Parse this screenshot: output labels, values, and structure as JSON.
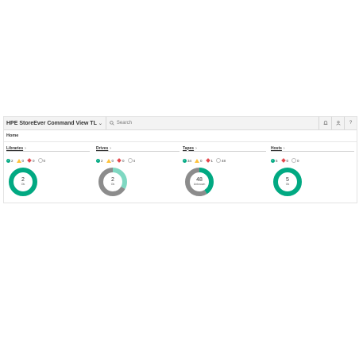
{
  "header": {
    "app_title": "HPE StoreEver Command View TL",
    "search_placeholder": "Search",
    "icons": [
      "bell-icon",
      "user-icon",
      "help-icon"
    ],
    "help_label": "?"
  },
  "breadcrumb": "Home",
  "colors": {
    "ok": "#01a982",
    "ok_light": "#7fd8c2",
    "unknown": "#8c8c8c",
    "warning": "#ffc23a",
    "critical": "#e5484d"
  },
  "panels": [
    {
      "title": "Libraries",
      "counts": {
        "ok": "2",
        "warning": "0",
        "critical": "0",
        "unknown": "0"
      },
      "donut": {
        "center_value": "2",
        "center_label": "Ok",
        "segments": [
          {
            "color": "#01a982",
            "fraction": 1.0
          }
        ]
      }
    },
    {
      "title": "Drives",
      "counts": {
        "ok": "2",
        "warning": "0",
        "critical": "0",
        "unknown": "4"
      },
      "donut": {
        "center_value": "2",
        "center_label": "Ok",
        "segments": [
          {
            "color": "#7fd8c2",
            "fraction": 0.333
          },
          {
            "color": "#8c8c8c",
            "fraction": 0.667
          }
        ]
      }
    },
    {
      "title": "Tapes",
      "counts": {
        "ok": "34",
        "warning": "0",
        "critical": "1",
        "unknown": "48"
      },
      "donut": {
        "center_value": "48",
        "center_label": "Unknown",
        "segments": [
          {
            "color": "#01a982",
            "fraction": 0.41
          },
          {
            "color": "#8c8c8c",
            "fraction": 0.59
          }
        ]
      }
    },
    {
      "title": "Hosts",
      "counts": {
        "ok": "5",
        "critical": "0",
        "unknown": "0"
      },
      "donut": {
        "center_value": "5",
        "center_label": "Ok",
        "segments": [
          {
            "color": "#01a982",
            "fraction": 1.0
          }
        ]
      }
    }
  ]
}
